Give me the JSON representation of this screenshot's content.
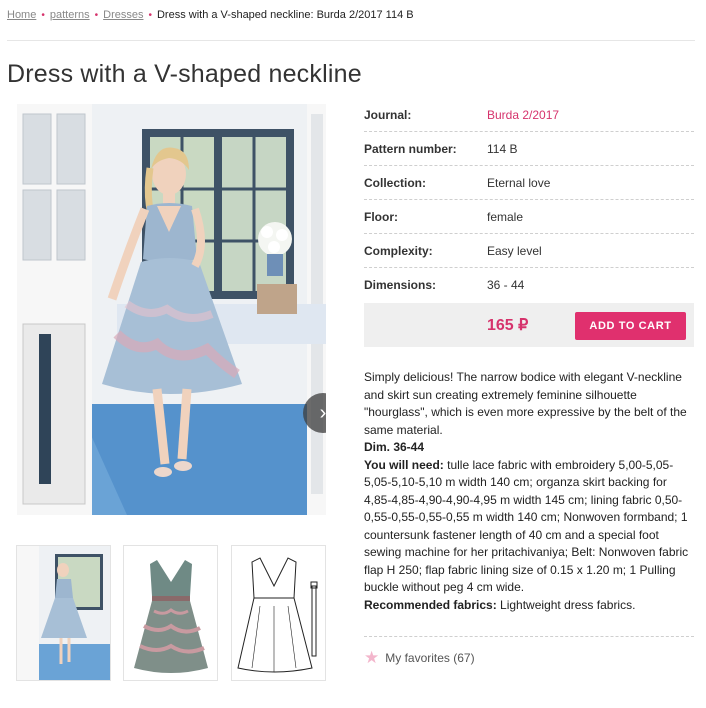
{
  "breadcrumb": {
    "home": "Home",
    "patterns": "patterns",
    "dresses": "Dresses",
    "current": "Dress with a V-shaped neckline: Burda 2/2017 114 B"
  },
  "title": "Dress with a V-shaped neckline",
  "specs": [
    {
      "label": "Journal:",
      "value": "Burda 2/2017"
    },
    {
      "label": "Pattern number:",
      "value": "114 B"
    },
    {
      "label": "Collection:",
      "value": "Eternal love"
    },
    {
      "label": "Floor:",
      "value": "female"
    },
    {
      "label": "Complexity:",
      "value": "Easy level"
    },
    {
      "label": "Dimensions:",
      "value": "36 - 44"
    }
  ],
  "price": "165 ₽",
  "cart_label": "ADD TO CART",
  "description": {
    "intro": "Simply delicious! The narrow bodice with elegant V-neckline and skirt sun creating extremely feminine silhouette \"hourglass\", which is even more expressive by the belt of the same material.",
    "dim": "Dim. 36-44",
    "need_label": "You will need:",
    "need_text": " tulle lace fabric with embroidery 5,00-5,05-5,05-5,10-5,10 m width 140 cm; organza skirt backing for 4,85-4,85-4,90-4,90-4,95 m width 145 cm; lining fabric 0,50-0,55-0,55-0,55-0,55 m width 140 cm; Nonwoven formband; 1 countersunk fastener length of 40 cm and a special foot sewing machine for her pritachivaniya; Belt: Nonwoven fabric flap H 250; flap fabric lining size of 0.15 x 1.20 m; 1 Pulling buckle without peg 4 cm wide.",
    "rec_label": "Recommended fabrics:",
    "rec_text": " Lightweight dress fabrics."
  },
  "favorites": "My favorites (67)",
  "colors": {
    "accent": "#e0306e",
    "link": "#d6336c"
  },
  "icons": {
    "next": "chevron-right-icon",
    "favorite": "star-icon"
  }
}
